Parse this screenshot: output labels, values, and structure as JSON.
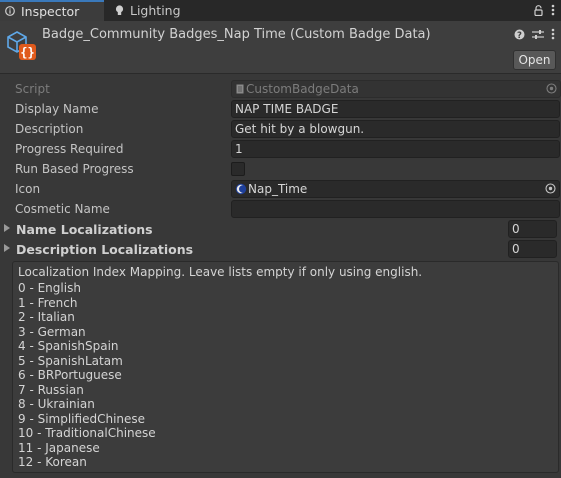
{
  "tabs": {
    "inspector": "Inspector",
    "lighting": "Lighting"
  },
  "header": {
    "title": "Badge_Community Badges_Nap Time (Custom Badge Data)",
    "open_button": "Open"
  },
  "fields": {
    "script": {
      "label": "Script",
      "value": "CustomBadgeData"
    },
    "display_name": {
      "label": "Display Name",
      "value": "NAP TIME BADGE"
    },
    "description": {
      "label": "Description",
      "value": "Get hit by a blowgun."
    },
    "progress_required": {
      "label": "Progress Required",
      "value": "1"
    },
    "run_based_progress": {
      "label": "Run Based Progress",
      "checked": false
    },
    "icon": {
      "label": "Icon",
      "value": "Nap_Time"
    },
    "cosmetic_name": {
      "label": "Cosmetic Name",
      "value": ""
    }
  },
  "lists": {
    "name_localizations": {
      "label": "Name Localizations",
      "count": "0"
    },
    "description_localizations": {
      "label": "Description Localizations",
      "count": "0"
    }
  },
  "help": {
    "title": "Localization Index Mapping. Leave lists empty if only using english.",
    "items": [
      "0 - English",
      "1 - French",
      "2 - Italian",
      "3 - German",
      "4 - SpanishSpain",
      "5 - SpanishLatam",
      "6 - BRPortuguese",
      "7 - Russian",
      "8 - Ukrainian",
      "9 - SimplifiedChinese",
      "10 - TraditionalChinese",
      "11 - Japanese",
      "12 - Korean"
    ]
  },
  "colors": {
    "accent": "#3a79bb",
    "background": "#383838",
    "field_background": "#2a2a2a"
  }
}
